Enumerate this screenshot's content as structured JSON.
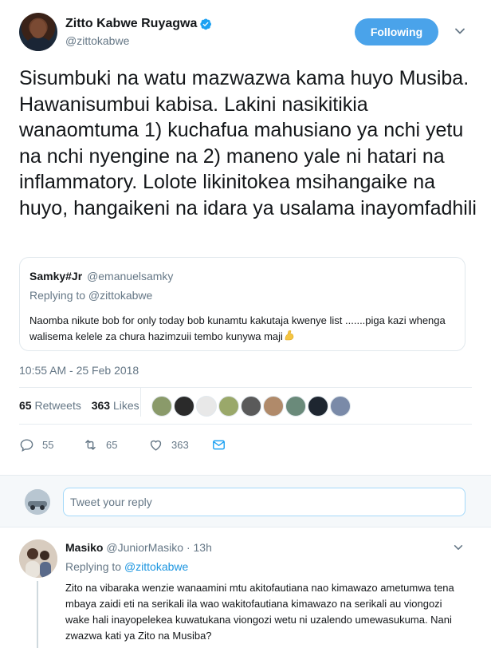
{
  "author": {
    "display_name": "Zitto Kabwe Ruyagwa",
    "handle": "@zittokabwe",
    "verified": true,
    "follow_state_label": "Following"
  },
  "tweet": {
    "text": "Sisumbuki na watu mazwazwa kama huyo Musiba. Hawanisumbui kabisa. Lakini nasikitikia wanaomtuma 1) kuchafua mahusiano ya nchi yetu na nchi nyengine na 2) maneno yale ni hatari na inflammatory. Lolote likinitokea msihangaike na huyo, hangaikeni na idara ya usalama inayomfadhili",
    "timestamp": "10:55 AM - 25 Feb 2018"
  },
  "quoted_tweet": {
    "display_name": "Samky#Jr",
    "handle": "@emanuelsamky",
    "replying_to": "Replying to @zittokabwe",
    "text": "Naomba nikute bob for only today bob kunamtu kakutaja kwenye list .......piga kazi whenga walisema kelele za chura hazimzuii tembo kunywa maji",
    "emoji": "flexed-biceps-emoji"
  },
  "stats": {
    "retweets_count": "65",
    "retweets_label": "Retweets",
    "likes_count": "363",
    "likes_label": "Likes",
    "liker_avatar_count": 9
  },
  "actions": {
    "reply_count": "55",
    "retweet_count": "65",
    "like_count": "363",
    "icons": [
      "reply-icon",
      "retweet-icon",
      "like-icon",
      "direct-message-icon"
    ]
  },
  "reply_box": {
    "placeholder": "Tweet your reply"
  },
  "reply": {
    "display_name": "Masiko",
    "handle": "@JuniorMasiko",
    "separator": "·",
    "age": "13h",
    "replying_prefix": "Replying to",
    "replying_to": "@zittokabwe",
    "text": "Zito na vibaraka wenzie wanaamini mtu akitofautiana nao kimawazo ametumwa tena mbaya zaidi eti na serikali ila wao wakitofautiana kimawazo na serikali au viongozi wake hali inayopelekea kuwatukana viongozi wetu ni uzalendo umewasukuma. Nani zwazwa kati ya Zito na Musiba?"
  },
  "colors": {
    "accent": "#1da1f2",
    "follow_button": "#4aa3ea",
    "secondary_text": "#657786",
    "primary_text": "#14171a",
    "border": "#e1e8ed",
    "reply_bar_bg": "#f5f8fa"
  }
}
